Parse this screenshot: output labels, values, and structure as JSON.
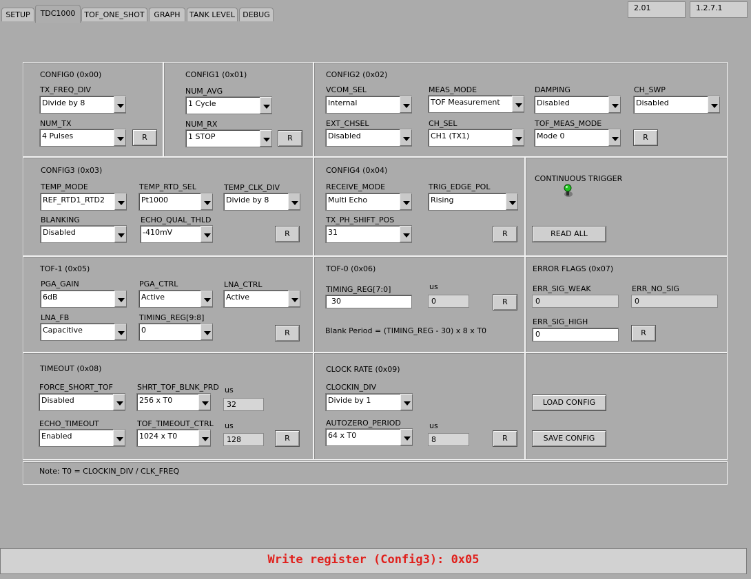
{
  "tabs": [
    "SETUP",
    "TDC1000",
    "TOF_ONE_SHOT",
    "GRAPH",
    "TANK LEVEL",
    "DEBUG"
  ],
  "active_tab": "TDC1000",
  "versions": [
    "2.01",
    "1.2.7.1"
  ],
  "reset_label": "R",
  "us_label": "us",
  "config0": {
    "title": "CONFIG0 (0x00)",
    "tx_freq_div": {
      "label": "TX_FREQ_DIV",
      "value": "Divide by 8"
    },
    "num_tx": {
      "label": "NUM_TX",
      "value": "4 Pulses"
    }
  },
  "config1": {
    "title": "CONFIG1 (0x01)",
    "num_avg": {
      "label": "NUM_AVG",
      "value": "1 Cycle"
    },
    "num_rx": {
      "label": "NUM_RX",
      "value": "1 STOP"
    }
  },
  "config2": {
    "title": "CONFIG2 (0x02)",
    "vcom_sel": {
      "label": "VCOM_SEL",
      "value": "Internal"
    },
    "meas_mode": {
      "label": "MEAS_MODE",
      "value": "TOF Measurement"
    },
    "damping": {
      "label": "DAMPING",
      "value": "Disabled"
    },
    "ch_swp": {
      "label": "CH_SWP",
      "value": "Disabled"
    },
    "ext_chsel": {
      "label": "EXT_CHSEL",
      "value": "Disabled"
    },
    "ch_sel": {
      "label": "CH_SEL",
      "value": "CH1 (TX1)"
    },
    "tof_meas_mode": {
      "label": "TOF_MEAS_MODE",
      "value": "Mode 0"
    }
  },
  "config3": {
    "title": "CONFIG3 (0x03)",
    "temp_mode": {
      "label": "TEMP_MODE",
      "value": "REF_RTD1_RTD2"
    },
    "temp_rtd_sel": {
      "label": "TEMP_RTD_SEL",
      "value": "Pt1000"
    },
    "temp_clk_div": {
      "label": "TEMP_CLK_DIV",
      "value": "Divide by 8"
    },
    "blanking": {
      "label": "BLANKING",
      "value": "Disabled"
    },
    "echo_qual_thld": {
      "label": "ECHO_QUAL_THLD",
      "value": "-410mV"
    }
  },
  "config4": {
    "title": "CONFIG4 (0x04)",
    "receive_mode": {
      "label": "RECEIVE_MODE",
      "value": "Multi Echo"
    },
    "trig_edge_pol": {
      "label": "TRIG_EDGE_POL",
      "value": "Rising"
    },
    "tx_ph_shift_pos": {
      "label": "TX_PH_SHIFT_POS",
      "value": "31"
    }
  },
  "trigger": {
    "title": "CONTINUOUS TRIGGER",
    "read_all": "READ ALL",
    "led_color": "#1fc41f"
  },
  "tof1": {
    "title": "TOF-1 (0x05)",
    "pga_gain": {
      "label": "PGA_GAIN",
      "value": "6dB"
    },
    "pga_ctrl": {
      "label": "PGA_CTRL",
      "value": "Active"
    },
    "lna_ctrl": {
      "label": "LNA_CTRL",
      "value": "Active"
    },
    "lna_fb": {
      "label": "LNA_FB",
      "value": "Capacitive"
    },
    "timing_reg_98": {
      "label": "TIMING_REG[9:8]",
      "value": "0"
    }
  },
  "tof0": {
    "title": "TOF-0 (0x06)",
    "timing_reg_70": {
      "label": "TIMING_REG[7:0]",
      "value": "30"
    },
    "us_value": "0",
    "formula": "Blank Period = (TIMING_REG - 30) x 8 x T0"
  },
  "errflags": {
    "title": "ERROR FLAGS (0x07)",
    "err_sig_weak": {
      "label": "ERR_SIG_WEAK",
      "value": "0"
    },
    "err_no_sig": {
      "label": "ERR_NO_SIG",
      "value": "0"
    },
    "err_sig_high": {
      "label": "ERR_SIG_HIGH",
      "value": "0"
    }
  },
  "timeout": {
    "title": "TIMEOUT (0x08)",
    "force_short_tof": {
      "label": "FORCE_SHORT_TOF",
      "value": "Disabled"
    },
    "shrt_tof_blnk_prd": {
      "label": "SHRT_TOF_BLNK_PRD",
      "value": "256 x T0"
    },
    "shrt_us": "32",
    "echo_timeout": {
      "label": "ECHO_TIMEOUT",
      "value": "Enabled"
    },
    "tof_timeout_ctrl": {
      "label": "TOF_TIMEOUT_CTRL",
      "value": "1024 x T0"
    },
    "timeout_us": "128"
  },
  "clockrate": {
    "title": "CLOCK RATE (0x09)",
    "clockin_div": {
      "label": "CLOCKIN_DIV",
      "value": "Divide by 1"
    },
    "autozero_period": {
      "label": "AUTOZERO_PERIOD",
      "value": "64 x T0"
    },
    "autozero_us": "8"
  },
  "config_buttons": {
    "load": "LOAD CONFIG",
    "save": "SAVE CONFIG"
  },
  "note": "Note: T0 = CLOCKIN_DIV / CLK_FREQ",
  "status": "Write register (Config3): 0x05"
}
